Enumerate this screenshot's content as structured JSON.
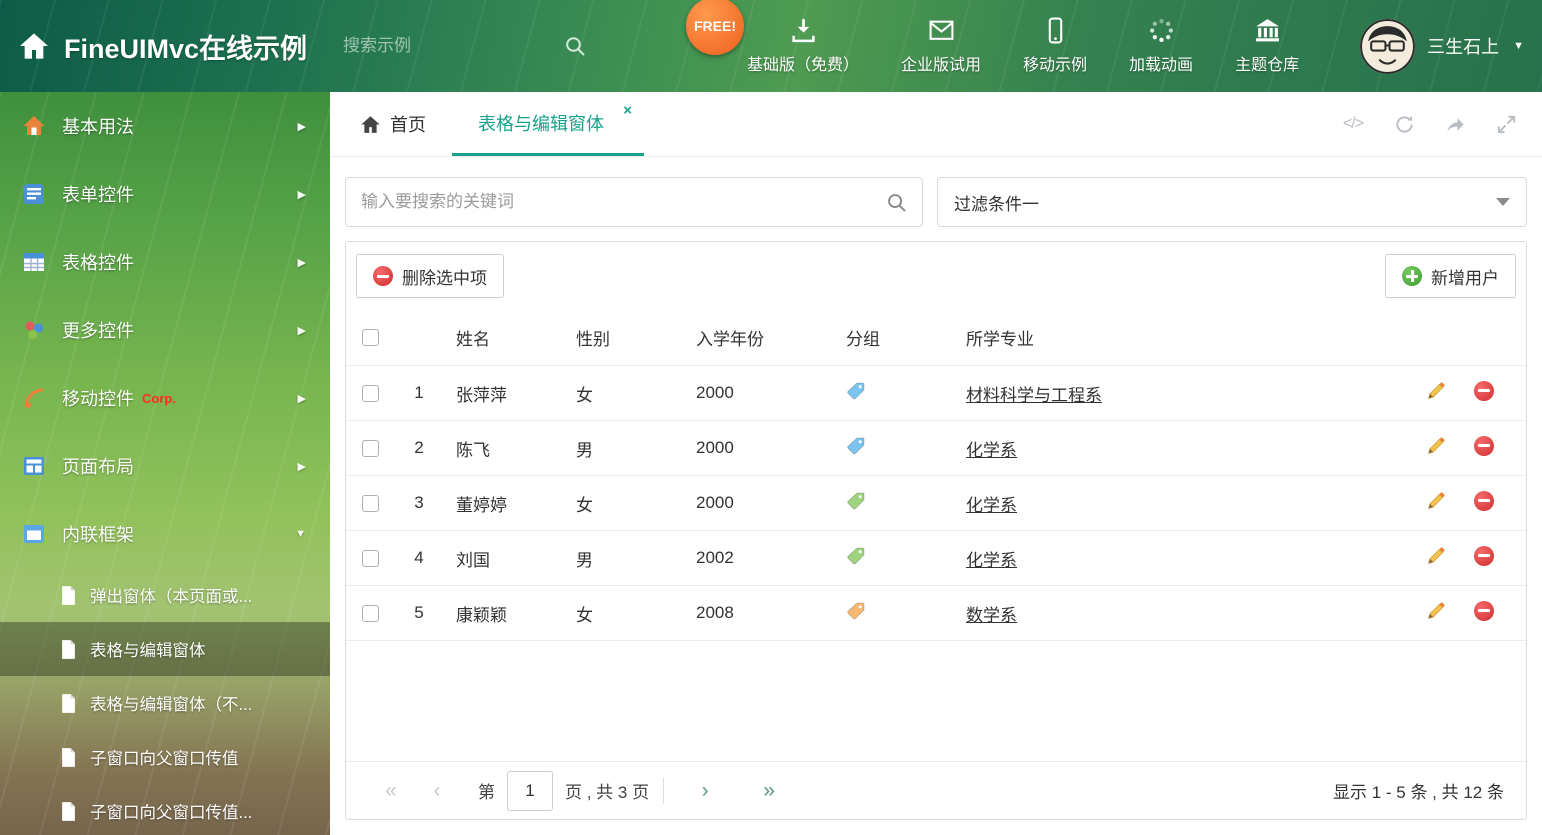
{
  "header": {
    "title": "FineUIMvc在线示例",
    "search_placeholder": "搜索示例",
    "free_badge": "FREE!",
    "nav_items": [
      {
        "label": "基础版（免费）",
        "icon": "download-icon"
      },
      {
        "label": "企业版试用",
        "icon": "mail-icon"
      },
      {
        "label": "移动示例",
        "icon": "mobile-icon"
      },
      {
        "label": "加载动画",
        "icon": "spinner-icon"
      },
      {
        "label": "主题仓库",
        "icon": "bank-icon"
      }
    ],
    "user_name": "三生石上"
  },
  "sidebar": {
    "items": [
      {
        "label": "基本用法",
        "icon": "home-menu-icon"
      },
      {
        "label": "表单控件",
        "icon": "form-menu-icon"
      },
      {
        "label": "表格控件",
        "icon": "grid-menu-icon"
      },
      {
        "label": "更多控件",
        "icon": "more-menu-icon"
      },
      {
        "label": "移动控件",
        "icon": "mobile-menu-icon",
        "badge": "Corp."
      },
      {
        "label": "页面布局",
        "icon": "layout-menu-icon"
      },
      {
        "label": "内联框架",
        "icon": "frame-menu-icon",
        "expanded": true
      }
    ],
    "subitems": [
      {
        "label": "弹出窗体（本页面或..."
      },
      {
        "label": "表格与编辑窗体",
        "active": true
      },
      {
        "label": "表格与编辑窗体（不..."
      },
      {
        "label": "子窗口向父窗口传值"
      },
      {
        "label": "子窗口向父窗口传值..."
      }
    ]
  },
  "tabs": {
    "home_label": "首页",
    "active_label": "表格与编辑窗体"
  },
  "filter": {
    "search_placeholder": "输入要搜索的关键词",
    "dropdown_value": "过滤条件一"
  },
  "toolbar": {
    "delete_label": "删除选中项",
    "add_label": "新增用户"
  },
  "table": {
    "columns": [
      "姓名",
      "性别",
      "入学年份",
      "分组",
      "所学专业"
    ],
    "rows": [
      {
        "num": "1",
        "name": "张萍萍",
        "gender": "女",
        "year": "2000",
        "tag_color": "#7cc4ef",
        "major": "材料科学与工程系"
      },
      {
        "num": "2",
        "name": "陈飞",
        "gender": "男",
        "year": "2000",
        "tag_color": "#7cc4ef",
        "major": "化学系"
      },
      {
        "num": "3",
        "name": "董婷婷",
        "gender": "女",
        "year": "2000",
        "tag_color": "#9fd37e",
        "major": "化学系"
      },
      {
        "num": "4",
        "name": "刘国",
        "gender": "男",
        "year": "2002",
        "tag_color": "#9fd37e",
        "major": "化学系"
      },
      {
        "num": "5",
        "name": "康颖颖",
        "gender": "女",
        "year": "2008",
        "tag_color": "#f6b873",
        "major": "数学系"
      }
    ]
  },
  "pagination": {
    "first_icon": "«",
    "prev_icon": "‹",
    "next_icon": "›",
    "last_icon": "»",
    "page_prefix": "第",
    "current_page": "1",
    "page_suffix": "页 , 共 3 页",
    "summary": "显示 1 - 5 条 , 共 12 条"
  },
  "colors": {
    "accent_teal": "#18a28c",
    "free_orange": "#ef5f1c",
    "delete_red": "#cf2e2e",
    "add_green": "#3d9c2f"
  }
}
